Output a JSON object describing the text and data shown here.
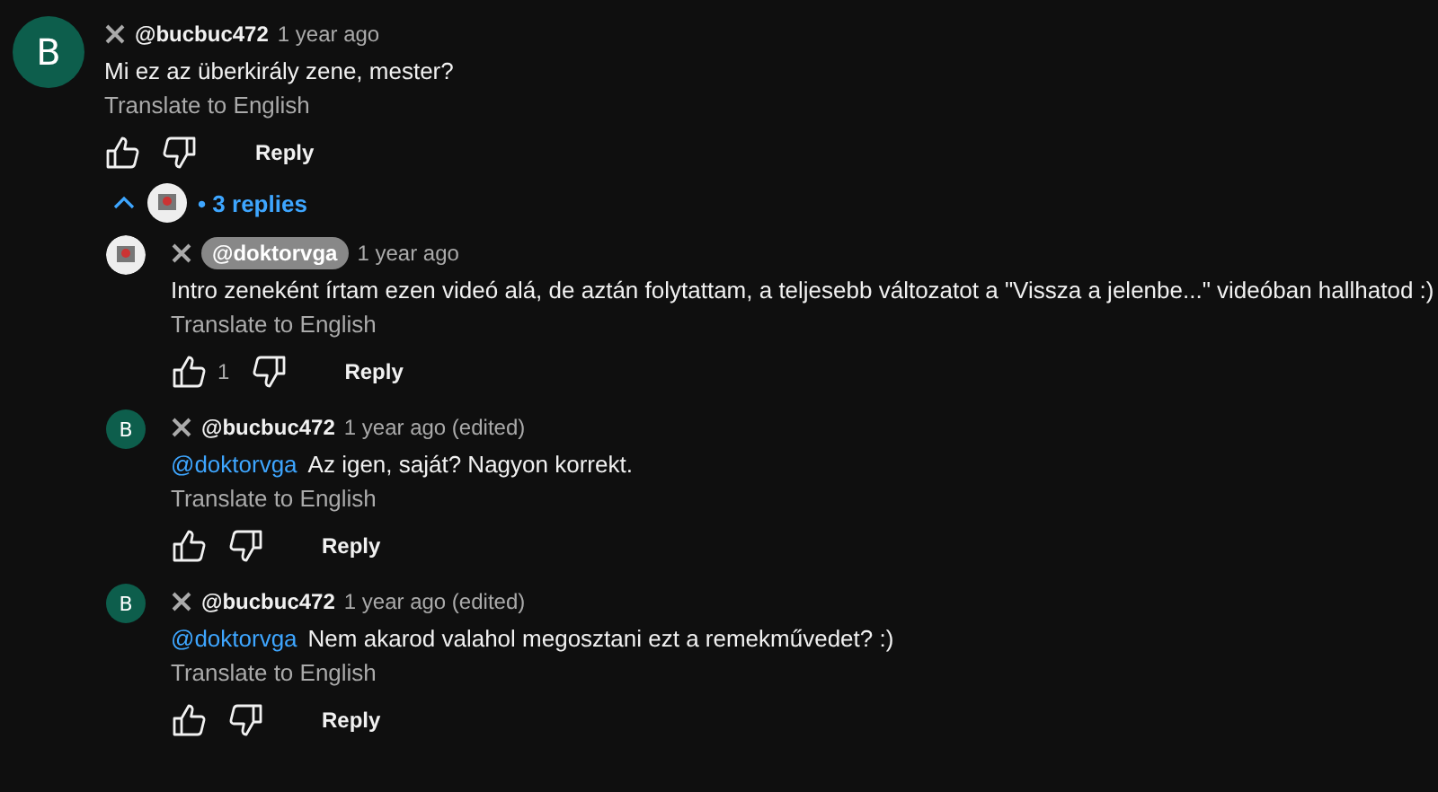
{
  "comment": {
    "avatar": {
      "kind": "letter",
      "letter": "B",
      "color": "#0d5e4c"
    },
    "author": "@bucbuc472",
    "creator": false,
    "time": "1 year ago",
    "body": "Mi ez az überkirály zene, mester?",
    "translate": "Translate to English",
    "reply": "Reply"
  },
  "replies_toggle": {
    "expanded": true,
    "label": "• 3 replies"
  },
  "replies": [
    {
      "avatar": {
        "kind": "image"
      },
      "author": "@doktorvga",
      "creator": true,
      "time": "1 year ago",
      "body": "Intro zeneként írtam ezen videó alá, de aztán folytattam, a teljesebb változatot a \"Vissza a jelenbe...\" videóban hallhatod :)",
      "translate": "Translate to English",
      "likes": "1",
      "reply": "Reply"
    },
    {
      "avatar": {
        "kind": "letter",
        "letter": "B",
        "color": "#0d5e4c"
      },
      "author": "@bucbuc472",
      "creator": false,
      "time": "1 year ago (edited)",
      "mention": "@doktorvga",
      "body": "Az igen, saját? Nagyon korrekt.",
      "translate": "Translate to English",
      "reply": "Reply"
    },
    {
      "avatar": {
        "kind": "letter",
        "letter": "B",
        "color": "#0d5e4c"
      },
      "author": "@bucbuc472",
      "creator": false,
      "time": "1 year ago (edited)",
      "mention": "@doktorvga",
      "body": "Nem akarod valahol megosztani ezt a remekművedet? :)",
      "translate": "Translate to English",
      "reply": "Reply"
    }
  ]
}
